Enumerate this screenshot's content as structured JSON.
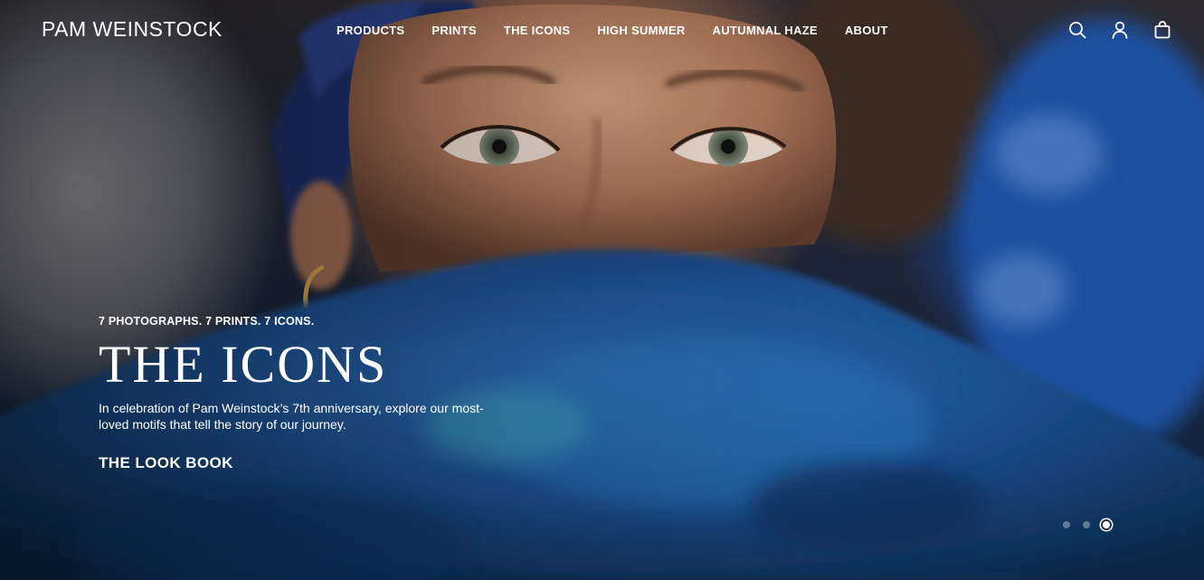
{
  "brand": {
    "name": "PAM WEINSTOCK"
  },
  "nav": {
    "items": [
      {
        "label": "PRODUCTS"
      },
      {
        "label": "PRINTS"
      },
      {
        "label": "THE ICONS"
      },
      {
        "label": "HIGH SUMMER"
      },
      {
        "label": "AUTUMNAL HAZE"
      },
      {
        "label": "ABOUT"
      }
    ]
  },
  "tools": {
    "search_icon": "search-icon",
    "account_icon": "user-icon",
    "cart_icon": "shopping-bag-icon"
  },
  "hero": {
    "kicker": "7 PHOTOGRAPHS. 7 PRINTS. 7 ICONS.",
    "headline": "THE ICONS",
    "description": "In celebration of Pam Weinstock’s 7th anniversary, explore our most-loved motifs that tell the story of our journey.",
    "cta_label": "THE LOOK BOOK"
  },
  "carousel": {
    "slide_count": 3,
    "active_slide": 3
  },
  "colors": {
    "text": "#ffffff",
    "accent_blue": "#1f4f9e"
  }
}
